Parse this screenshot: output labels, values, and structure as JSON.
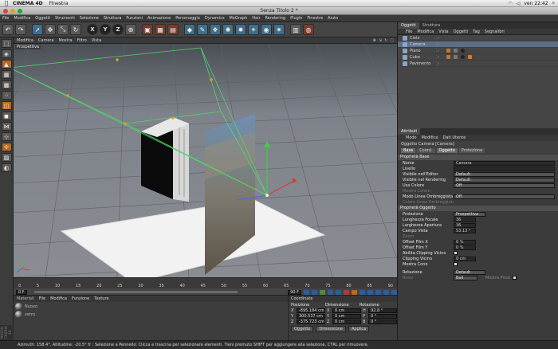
{
  "mac": {
    "app": "CINEMA 4D",
    "menu": [
      "Finestra"
    ],
    "clock": "ven 22:42"
  },
  "window": {
    "title": "Senza Titolo 2 *"
  },
  "menubar": [
    "File",
    "Modifica",
    "Oggetti",
    "Strumenti",
    "Selezione",
    "Struttura",
    "Funzioni",
    "Animazione",
    "Personaggio",
    "Dynamics",
    "MoGraph",
    "Hair",
    "Rendering",
    "Plugin",
    "Finestre",
    "Aiuto"
  ],
  "toolbar": {
    "axis": [
      "X",
      "Y",
      "Z"
    ]
  },
  "viewport": {
    "menu": [
      "Modifica",
      "Camera",
      "Mostra",
      "Filtro",
      "Vista"
    ],
    "label": "Prospettiva"
  },
  "timeline": {
    "ticks": [
      "0",
      "5",
      "10",
      "15",
      "20",
      "25",
      "30",
      "35",
      "40",
      "45",
      "50",
      "55",
      "60",
      "65",
      "70",
      "75",
      "80",
      "85",
      "90"
    ],
    "start_field": "0 F",
    "end_field": "90 F"
  },
  "materials": {
    "menu": [
      "Materiali",
      "File",
      "Modifica",
      "Funzione",
      "Texture"
    ],
    "items": [
      "Nuovo",
      "vetro"
    ]
  },
  "coordinates": {
    "title": "Coordinate",
    "headers": [
      "Posizione",
      "Dimensione",
      "Rotazione"
    ],
    "rows": [
      {
        "axis": "X",
        "pos": "-895.184 cm",
        "dim": "0 cm",
        "rot_axis": "H",
        "rot": "92.8 °"
      },
      {
        "axis": "Y",
        "pos": "300.537 cm",
        "dim": "0 cm",
        "rot_axis": "P",
        "rot": "0 °"
      },
      {
        "axis": "Z",
        "pos": "-375.723 cm",
        "dim": "0 cm",
        "rot_axis": "B",
        "rot": "0 °"
      }
    ],
    "buttons": [
      "Oggetto",
      "Dimensione",
      "Applica"
    ]
  },
  "object_manager": {
    "tabs": [
      "Oggetti",
      "Struttura"
    ],
    "menu": [
      "File",
      "Modifica",
      "Vista",
      "Oggetti",
      "Tag",
      "Segnalibri"
    ],
    "objects": [
      "Cielo",
      "Camera",
      "Piano",
      "Cubo",
      "Pavimento"
    ]
  },
  "attributes": {
    "tab": "Attributi",
    "menu": [
      "Modo",
      "Modifica",
      "Dati Utente"
    ],
    "object_line": "Oggetto Camera [Camera]",
    "subtabs": [
      "Base",
      "Coord.",
      "Oggetto",
      "Protezione"
    ],
    "base_header": "Proprietà Base",
    "base_rows": [
      {
        "k": "Nome",
        "v": "Camera"
      },
      {
        "k": "Livello",
        "v": ""
      },
      {
        "k": "Visibile nell'Editor",
        "v": "Default"
      },
      {
        "k": "Visibile nel Rendering",
        "v": "Default"
      },
      {
        "k": "Usa Colore",
        "v": "Off"
      },
      {
        "k": "Mostra Colore",
        "v": ""
      },
      {
        "k": "Modo Linea Ombreggiata",
        "v": "Off"
      },
      {
        "k": "Colore Linea Ombreggiata",
        "v": ""
      }
    ],
    "obj_header": "Proprietà Oggetto",
    "obj_rows": [
      {
        "k": "Proiezione",
        "v": "Prospettiva"
      },
      {
        "k": "Lunghezza Focale",
        "v": "36"
      },
      {
        "k": "Larghezza Apertura",
        "v": "36"
      },
      {
        "k": "Campo Vista",
        "v": "53.13 °"
      },
      {
        "k": "Zoom",
        "v": ""
      },
      {
        "k": "Offset Film X",
        "v": "0 %"
      },
      {
        "k": "Offset Film Y",
        "v": "0 %"
      },
      {
        "k": "Abilita Clipping Vicino",
        "v": ""
      },
      {
        "k": "Clipping Vicino",
        "v": "0 cm"
      },
      {
        "k": "Mostra Cono",
        "v": ""
      },
      {
        "k": "Rotazione",
        "v": "Default"
      },
      {
        "k": "Rossi",
        "v": "Ball"
      }
    ],
    "mostra_pivot": "Mostra Pivot"
  },
  "status": "Azimuth: 158.4°, Altitudine: -20.5°  fr : Selezione a Pennello: Clicca e trascina per selezionare elementi. Tieni premuto SHIFT per aggiungere alla selezione, CTRL per rimuovere.",
  "maxon": "MAXON CINEMA 4D",
  "colors": {
    "accent": "#c8782c",
    "selection": "#3f6f8a"
  }
}
